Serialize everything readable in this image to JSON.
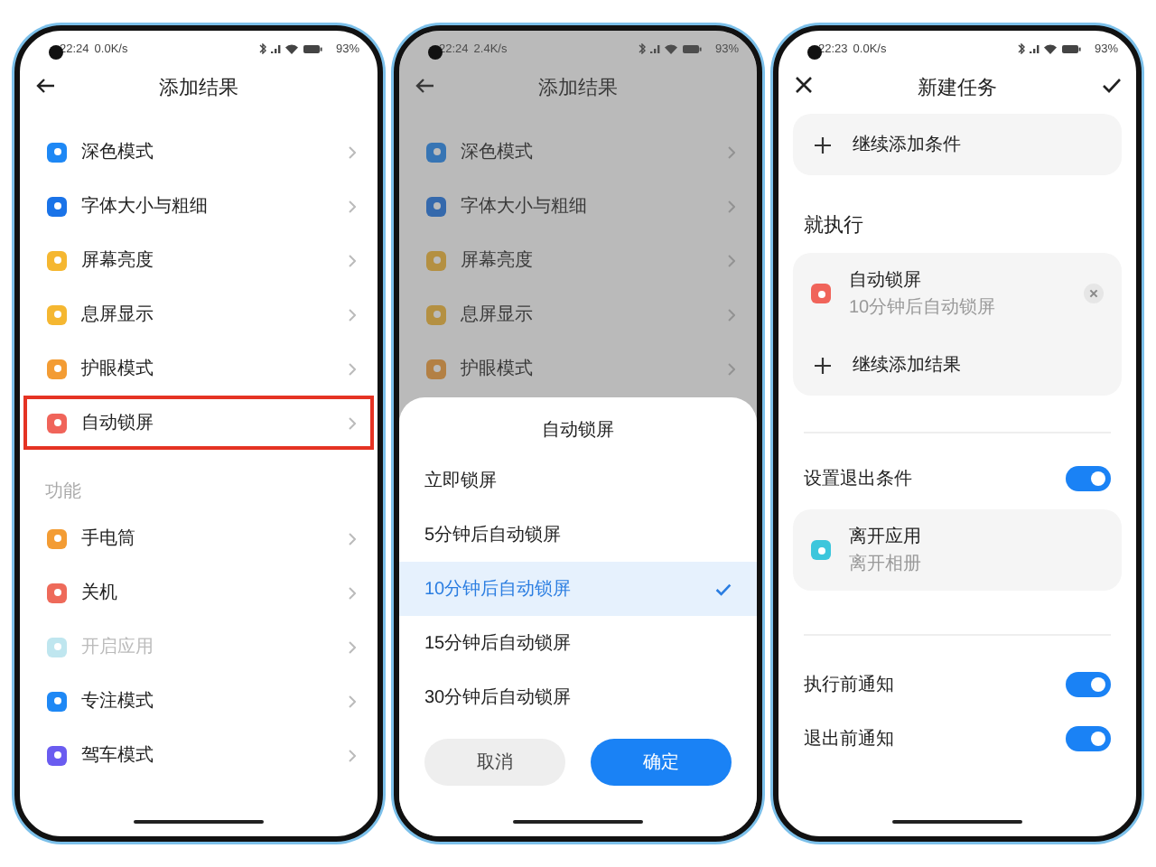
{
  "result_list_screen": {
    "status": {
      "time": "22:24",
      "speed": "0.0K/s",
      "battery": "93%"
    },
    "title": "添加结果",
    "items": [
      {
        "label": "深色模式",
        "color": "#1e88f5",
        "highlighted": false,
        "disabled": false
      },
      {
        "label": "字体大小与粗细",
        "color": "#1a73e8",
        "highlighted": false,
        "disabled": false
      },
      {
        "label": "屏幕亮度",
        "color": "#f5b731",
        "highlighted": false,
        "disabled": false
      },
      {
        "label": "息屏显示",
        "color": "#f5b731",
        "highlighted": false,
        "disabled": false
      },
      {
        "label": "护眼模式",
        "color": "#f39c34",
        "highlighted": false,
        "disabled": false
      },
      {
        "label": "自动锁屏",
        "color": "#f0645a",
        "highlighted": true,
        "disabled": false
      }
    ],
    "section": "功能",
    "section_items": [
      {
        "label": "手电筒",
        "color": "#f39c34",
        "highlighted": false,
        "disabled": false
      },
      {
        "label": "关机",
        "color": "#ee6a5a",
        "highlighted": false,
        "disabled": false
      },
      {
        "label": "开启应用",
        "color": "#bfe6ef",
        "highlighted": false,
        "disabled": true
      },
      {
        "label": "专注模式",
        "color": "#1e88f5",
        "highlighted": false,
        "disabled": false
      },
      {
        "label": "驾车模式",
        "color": "#6a5cf0",
        "highlighted": false,
        "disabled": false
      }
    ]
  },
  "picker_screen": {
    "status": {
      "time": "22:24",
      "speed": "2.4K/s",
      "battery": "93%"
    },
    "title": "添加结果",
    "items": [
      {
        "label": "深色模式",
        "color": "#3775b4"
      },
      {
        "label": "字体大小与粗细",
        "color": "#3569ac"
      },
      {
        "label": "屏幕亮度",
        "color": "#b49042"
      },
      {
        "label": "息屏显示",
        "color": "#b49042"
      },
      {
        "label": "护眼模式",
        "color": "#b38044"
      }
    ],
    "sheet": {
      "title": "自动锁屏",
      "options": [
        {
          "label": "立即锁屏",
          "selected": false
        },
        {
          "label": "5分钟后自动锁屏",
          "selected": false
        },
        {
          "label": "10分钟后自动锁屏",
          "selected": true
        },
        {
          "label": "15分钟后自动锁屏",
          "selected": false
        },
        {
          "label": "30分钟后自动锁屏",
          "selected": false
        }
      ],
      "cancel": "取消",
      "confirm": "确定"
    }
  },
  "new_task_screen": {
    "status": {
      "time": "22:23",
      "speed": "0.0K/s",
      "battery": "93%"
    },
    "title": "新建任务",
    "add_condition": "继续添加条件",
    "section": "就执行",
    "action": {
      "title": "自动锁屏",
      "subtitle": "10分钟后自动锁屏",
      "color": "#f0645a"
    },
    "add_result": "继续添加结果",
    "toggles": [
      {
        "label": "设置退出条件",
        "on": true
      }
    ],
    "exit_condition": {
      "title": "离开应用",
      "subtitle": "离开相册",
      "color": "#3cc6dc"
    },
    "notify_toggles": [
      {
        "label": "执行前通知",
        "on": true
      },
      {
        "label": "退出前通知",
        "on": true
      }
    ]
  }
}
